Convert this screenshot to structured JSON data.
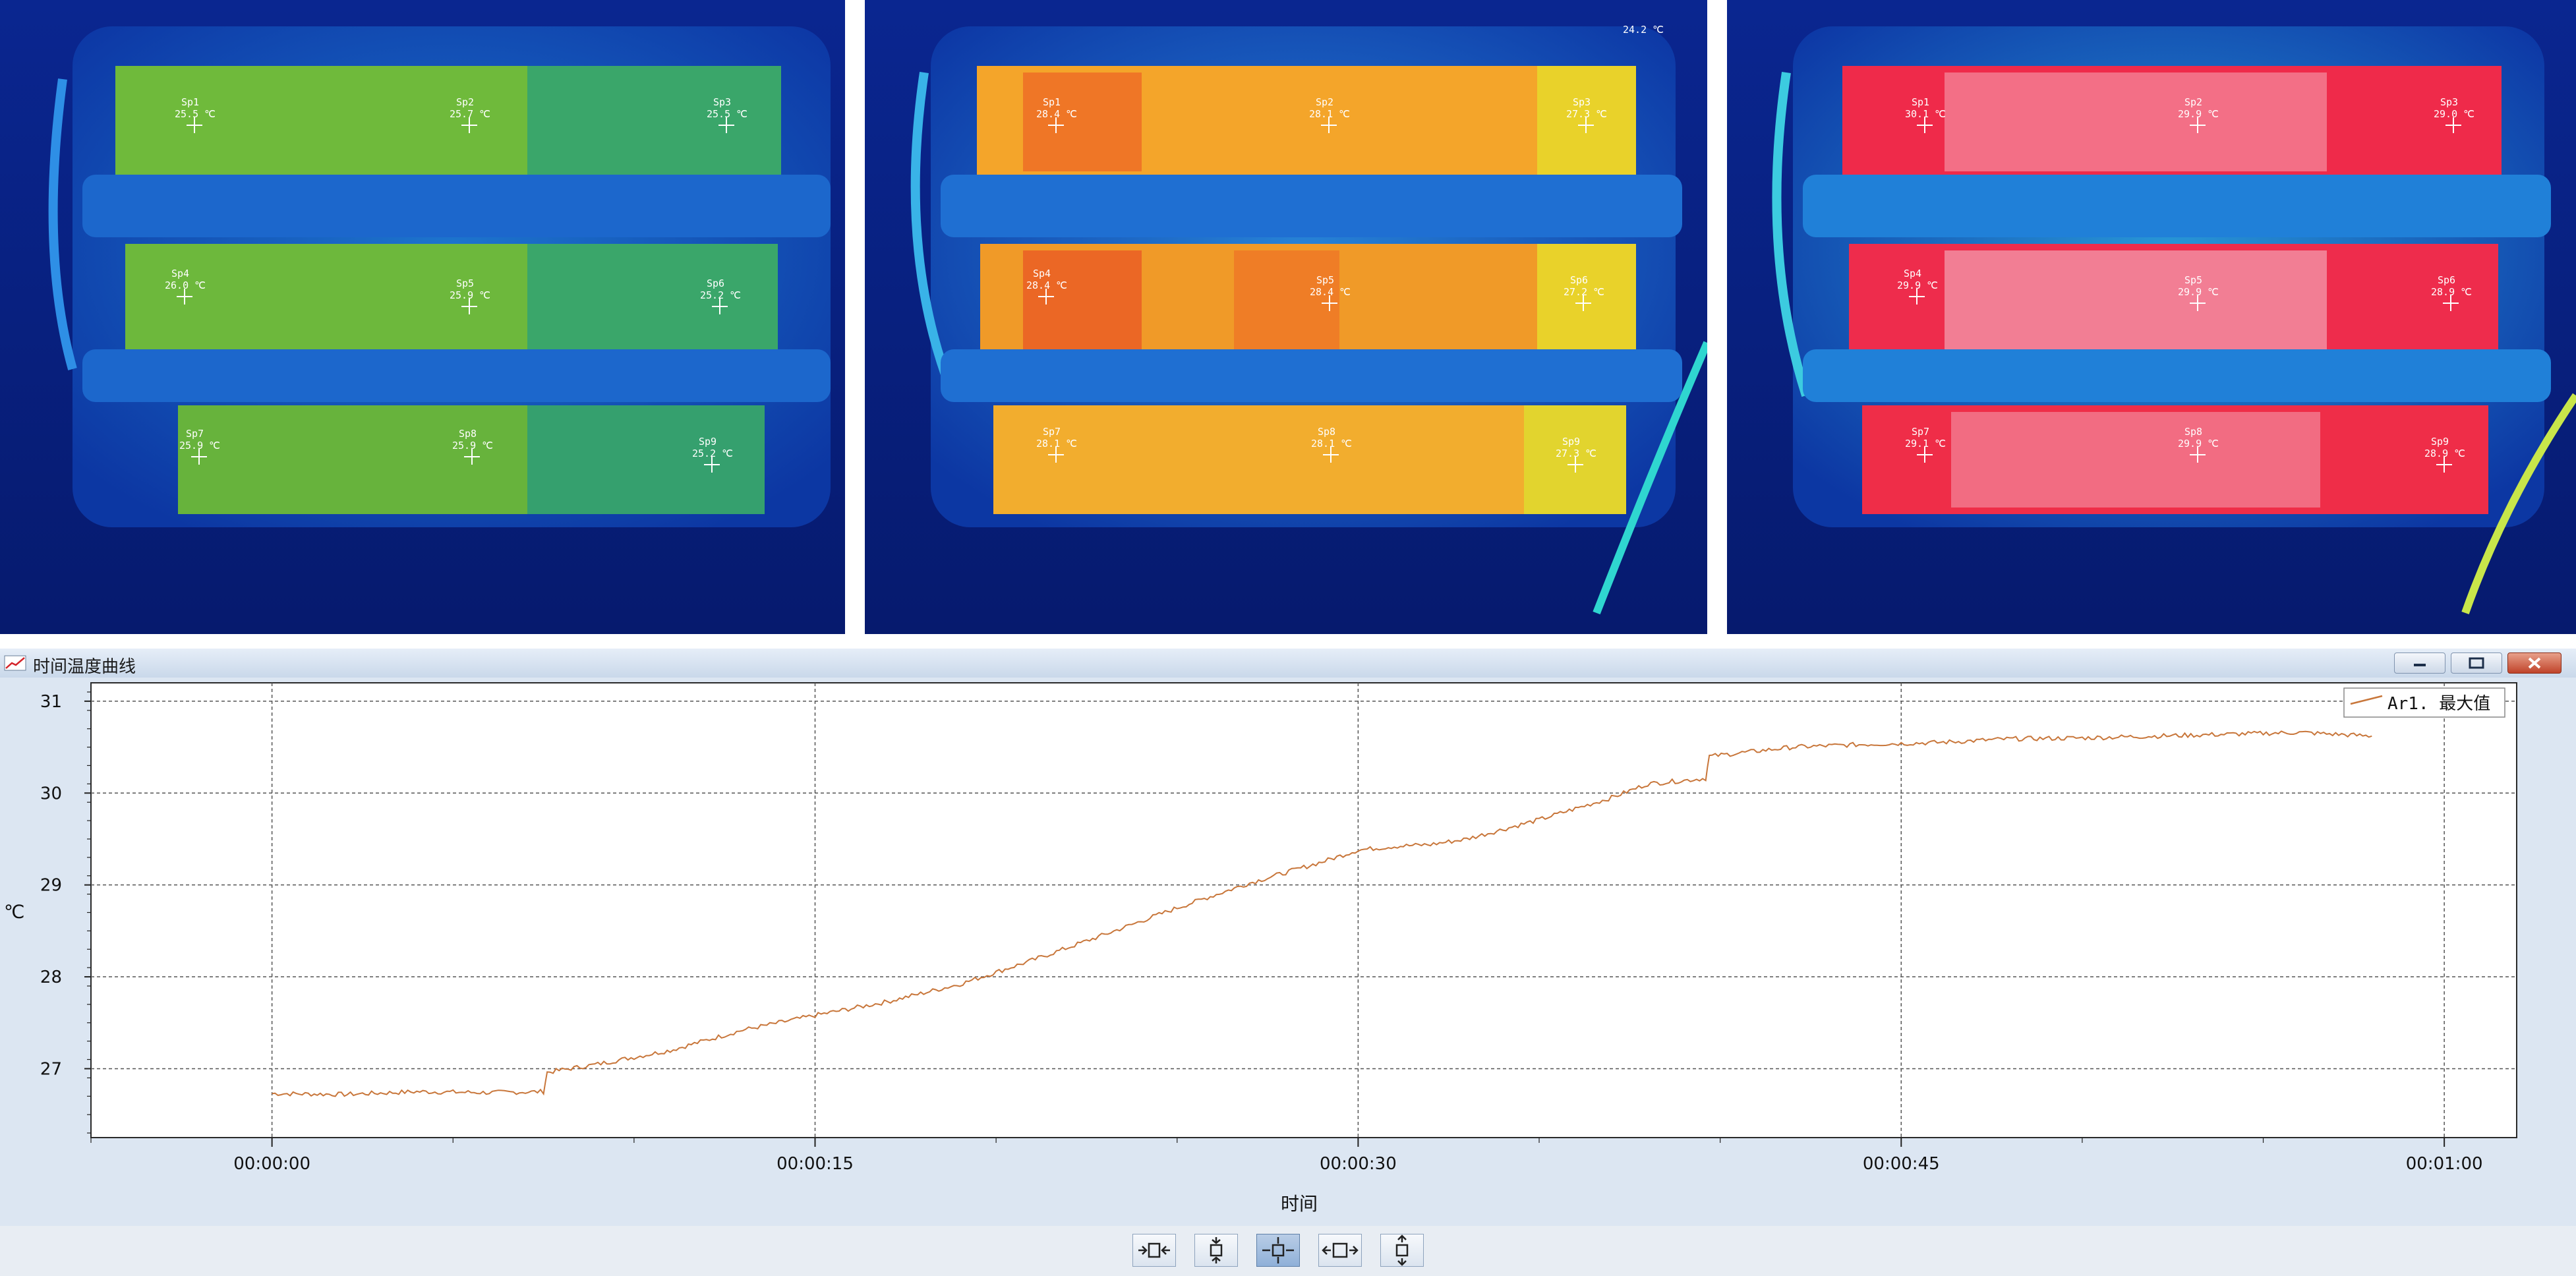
{
  "thermal_images": [
    {
      "id": "frame-1",
      "top_label": "",
      "palette": "cool",
      "spots": [
        {
          "name": "Sp1",
          "temp": "25.5 ℃"
        },
        {
          "name": "Sp2",
          "temp": "25.7 ℃"
        },
        {
          "name": "Sp3",
          "temp": "25.5 ℃"
        },
        {
          "name": "Sp4",
          "temp": "26.0 ℃"
        },
        {
          "name": "Sp5",
          "temp": "25.9 ℃"
        },
        {
          "name": "Sp6",
          "temp": "25.2 ℃"
        },
        {
          "name": "Sp7",
          "temp": "25.9 ℃"
        },
        {
          "name": "Sp8",
          "temp": "25.9 ℃"
        },
        {
          "name": "Sp9",
          "temp": "25.2 ℃"
        }
      ]
    },
    {
      "id": "frame-2",
      "top_label": "24.2 ℃",
      "palette": "warm",
      "spots": [
        {
          "name": "Sp1",
          "temp": "28.4 ℃"
        },
        {
          "name": "Sp2",
          "temp": "28.1 ℃"
        },
        {
          "name": "Sp3",
          "temp": "27.3 ℃"
        },
        {
          "name": "Sp4",
          "temp": "28.4 ℃"
        },
        {
          "name": "Sp5",
          "temp": "28.4 ℃"
        },
        {
          "name": "Sp6",
          "temp": "27.2 ℃"
        },
        {
          "name": "Sp7",
          "temp": "28.1 ℃"
        },
        {
          "name": "Sp8",
          "temp": "28.1 ℃"
        },
        {
          "name": "Sp9",
          "temp": "27.3 ℃"
        }
      ]
    },
    {
      "id": "frame-3",
      "top_label": "",
      "palette": "hot",
      "spots": [
        {
          "name": "Sp1",
          "temp": "30.1 ℃"
        },
        {
          "name": "Sp2",
          "temp": "29.9 ℃"
        },
        {
          "name": "Sp3",
          "temp": "29.0 ℃"
        },
        {
          "name": "Sp4",
          "temp": "29.9 ℃"
        },
        {
          "name": "Sp5",
          "temp": "29.9 ℃"
        },
        {
          "name": "Sp6",
          "temp": "28.9 ℃"
        },
        {
          "name": "Sp7",
          "temp": "29.1 ℃"
        },
        {
          "name": "Sp8",
          "temp": "29.9 ℃"
        },
        {
          "name": "Sp9",
          "temp": "28.9 ℃"
        }
      ]
    }
  ],
  "window": {
    "title": "时间温度曲线",
    "title_icon": "line-chart-icon",
    "buttons": [
      "minimize-icon",
      "restore-icon",
      "close-icon"
    ]
  },
  "toolbar": {
    "buttons": [
      {
        "name": "fit-horizontal-button",
        "icon": "fit-horizontal-icon",
        "active": false
      },
      {
        "name": "fit-vertical-button",
        "icon": "fit-vertical-icon",
        "active": false
      },
      {
        "name": "fit-all-button",
        "icon": "fit-all-icon",
        "active": true
      },
      {
        "name": "zoom-horizontal-button",
        "icon": "zoom-horizontal-icon",
        "active": false
      },
      {
        "name": "zoom-vertical-button",
        "icon": "zoom-vertical-icon",
        "active": false
      }
    ]
  },
  "chart_data": {
    "type": "line",
    "xlabel": "时间",
    "ylabel": "℃",
    "xlim": [
      -5,
      62
    ],
    "ylim": [
      26.25,
      31.2
    ],
    "x_ticks": [
      0,
      15,
      30,
      45,
      60
    ],
    "x_tick_labels": [
      "00:00:00",
      "00:00:15",
      "00:00:30",
      "00:00:45",
      "00:01:00"
    ],
    "y_ticks": [
      27,
      28,
      29,
      30,
      31
    ],
    "y_tick_labels": [
      "27",
      "28",
      "29",
      "30",
      "31"
    ],
    "grid": true,
    "legend": "top-right",
    "series": [
      {
        "name": "Ar1. 最大值",
        "color": "#c8763a",
        "x": [
          0,
          2,
          4,
          6,
          7.5,
          7.6,
          9,
          11,
          13,
          15,
          17,
          19,
          21,
          23,
          25,
          27,
          29,
          30,
          31,
          32,
          33,
          35,
          37,
          38,
          39.6,
          39.7,
          42,
          44,
          46,
          48,
          50,
          52,
          54,
          56,
          58
        ],
        "y": [
          26.73,
          26.72,
          26.75,
          26.74,
          26.75,
          26.96,
          27.05,
          27.2,
          27.42,
          27.58,
          27.73,
          27.92,
          28.18,
          28.46,
          28.75,
          29.02,
          29.25,
          29.38,
          29.42,
          29.44,
          29.5,
          29.71,
          29.95,
          30.1,
          30.16,
          30.4,
          30.5,
          30.53,
          30.55,
          30.59,
          30.6,
          30.62,
          30.64,
          30.66,
          30.62
        ]
      }
    ]
  }
}
